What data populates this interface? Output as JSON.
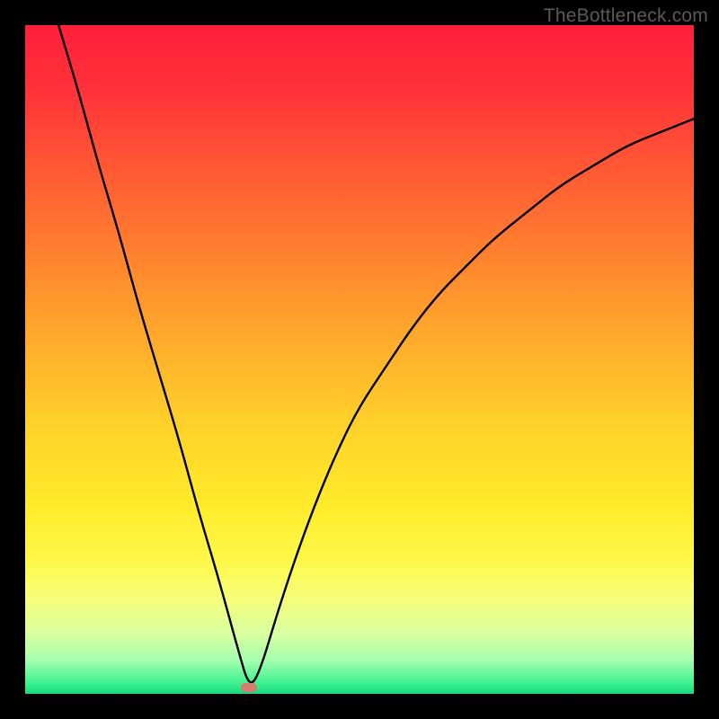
{
  "watermark": "TheBottleneck.com",
  "colors": {
    "gradient_stops": [
      {
        "offset": 0.0,
        "color": "#ff1f3a"
      },
      {
        "offset": 0.1,
        "color": "#ff3339"
      },
      {
        "offset": 0.22,
        "color": "#ff5a34"
      },
      {
        "offset": 0.35,
        "color": "#ff842f"
      },
      {
        "offset": 0.48,
        "color": "#ffae2c"
      },
      {
        "offset": 0.6,
        "color": "#ffd22a"
      },
      {
        "offset": 0.72,
        "color": "#ffeb2b"
      },
      {
        "offset": 0.8,
        "color": "#fff84a"
      },
      {
        "offset": 0.86,
        "color": "#f6ff7c"
      },
      {
        "offset": 0.91,
        "color": "#d8ffa0"
      },
      {
        "offset": 0.95,
        "color": "#a6ffb0"
      },
      {
        "offset": 0.985,
        "color": "#3cf08e"
      },
      {
        "offset": 1.0,
        "color": "#17d882"
      }
    ],
    "curve": "#000000",
    "marker": "#d97a6e",
    "frame_bg": "#000000"
  },
  "chart_data": {
    "type": "line",
    "title": "",
    "xlabel": "",
    "ylabel": "",
    "xlim": [
      0,
      100
    ],
    "ylim": [
      0,
      100
    ],
    "legend": false,
    "grid": false,
    "series": [
      {
        "name": "bottleneck-curve",
        "x": [
          5,
          8,
          11,
          14,
          17,
          20,
          23,
          26,
          29,
          32,
          33.5,
          35,
          38,
          41,
          44,
          47,
          50,
          54,
          58,
          62,
          66,
          70,
          75,
          80,
          85,
          90,
          95,
          100
        ],
        "y": [
          100,
          90,
          79,
          69,
          58,
          48,
          38,
          27,
          17,
          6,
          1,
          3,
          13,
          22,
          30,
          37,
          43,
          49,
          55,
          60,
          64,
          68,
          72,
          76,
          79,
          82,
          84,
          86
        ]
      }
    ],
    "annotations": [
      {
        "name": "optimal-marker",
        "x": 33.5,
        "y": 1
      }
    ]
  }
}
